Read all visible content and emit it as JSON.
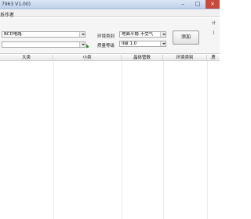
{
  "window": {
    "title": "7963 V1.00)"
  },
  "menu": {
    "label": "系作者"
  },
  "form": {
    "combo1_value": "BCD电路",
    "combo2_value": "",
    "env_type_label": "环境类别",
    "env_type_value": "地面平稳  不受气",
    "quality_grade_label": "质量等级",
    "quality_grade_value": "II级 1.0",
    "add_button_label": "添加",
    "side_text_1": "计",
    "side_text_2": "J"
  },
  "table": {
    "columns": [
      "大类",
      "小类",
      "晶体管数",
      "环境类别",
      "质"
    ]
  }
}
